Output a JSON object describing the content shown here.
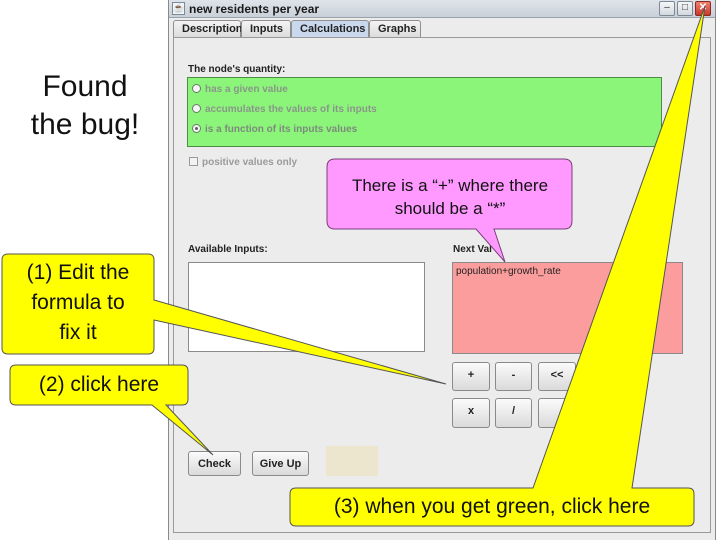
{
  "window": {
    "title": "new residents per year",
    "tabs": [
      "Description",
      "Inputs",
      "Calculations",
      "Graphs"
    ],
    "active_tab": "Calculations"
  },
  "calc": {
    "quantity_heading": "The node's quantity:",
    "options": [
      "has a given value",
      "accumulates the values of its inputs",
      "is a function of its inputs values"
    ],
    "selected_option": "is a function of its inputs values",
    "positive_only_label": "positive values only",
    "available_inputs_label": "Available Inputs:",
    "next_value_label": "Next Val",
    "formula": "population+growth_rate",
    "ops_row1": [
      "+",
      "-",
      "<<"
    ],
    "ops_row2": [
      "x",
      "/"
    ],
    "check_label": "Check",
    "give_up_label": "Give Up"
  },
  "annotations": {
    "headline_line1": "Found",
    "headline_line2": "the bug!",
    "bubble_line1": "There is a “+” where there",
    "bubble_line2": "should be a “*”",
    "step1_line1": "(1) Edit the",
    "step1_line2": "formula to",
    "step1_line3": "fix it",
    "step2": "(2) click here",
    "step3": "(3) when you get green, click here"
  },
  "colors": {
    "radio_panel": "#8bf57a",
    "formula_panel": "#fc9d9d",
    "callout_yellow": "#ffff00",
    "bubble_pink": "#ff99ff"
  }
}
